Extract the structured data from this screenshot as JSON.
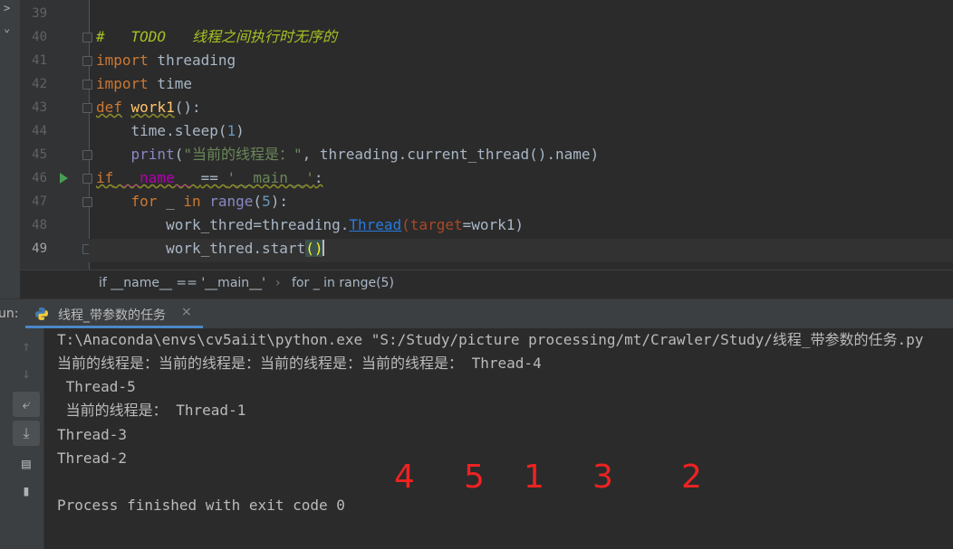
{
  "editor": {
    "line_numbers": [
      "39",
      "40",
      "41",
      "42",
      "43",
      "44",
      "45",
      "46",
      "47",
      "48",
      "49"
    ],
    "lines": {
      "l40": {
        "todo": "#   TODO   线程之间执行时无序的"
      },
      "l41": {
        "kw": "import",
        "rest": " threading"
      },
      "l42": {
        "kw": "import",
        "rest": " time"
      },
      "l43": {
        "kw": "def",
        "fn": "work1",
        "rest": "():"
      },
      "l44": {
        "pre": "    time.sleep(",
        "num": "1",
        "post": ")"
      },
      "l45": {
        "pre": "    ",
        "bi": "print",
        "p1": "(",
        "str": "\"当前的线程是：\"",
        "post": ", threading.current_thread().name)"
      },
      "l46": {
        "kw": "if",
        "d1": " __name__ ",
        "op": "== ",
        "str": "'__main__'",
        "post": ":"
      },
      "l47": {
        "pre": "    ",
        "kw": "for",
        "mid": " _ ",
        "kw2": "in",
        "sp": " ",
        "bi": "range",
        "p1": "(",
        "num": "5",
        "post": "):"
      },
      "l48": {
        "pre": "        work_thred=threading.",
        "link": "Thread",
        "p1": "(",
        "param": "target",
        "post": "=work1)"
      },
      "l49": {
        "pre": "        work_thred.start",
        "paren": "()"
      }
    }
  },
  "breadcrumb": {
    "item1": "if __name__ == '__main__'",
    "sep": "›",
    "item2": "for _ in range(5)"
  },
  "run_panel": {
    "label": "un:",
    "tab_title": "线程_带参数的任务",
    "tab_close": "×",
    "output": [
      "T:\\Anaconda\\envs\\cv5aiit\\python.exe \"S:/Study/picture processing/mt/Crawler/Study/线程_带参数的任务.py",
      "当前的线程是：当前的线程是：当前的线程是：当前的线程是： Thread-4",
      " Thread-5",
      " 当前的线程是： Thread-1",
      "Thread-3",
      "Thread-2",
      "",
      "Process finished with exit code 0"
    ]
  },
  "annotations": [
    "4",
    "5",
    "1",
    "3",
    "2"
  ],
  "colors": {
    "annotation": "#ee2222",
    "keyword": "#cc7832",
    "string": "#6a8759",
    "number": "#6897bb"
  }
}
